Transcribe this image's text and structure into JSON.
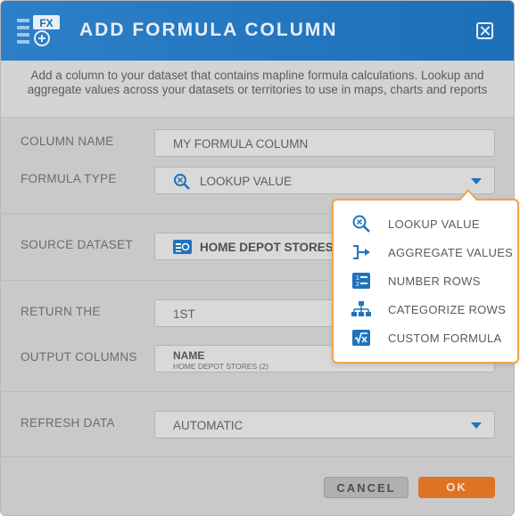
{
  "dialog": {
    "title": "ADD FORMULA COLUMN",
    "logo_text": "FX",
    "description": "Add a column to your dataset that contains mapline formula calculations. Lookup and aggregate values across your datasets or territories to use in maps, charts and reports"
  },
  "form": {
    "column_name": {
      "label": "COLUMN NAME",
      "value": "MY FORMULA COLUMN"
    },
    "formula_type": {
      "label": "FORMULA TYPE",
      "value": "LOOKUP VALUE"
    },
    "source_dataset": {
      "label": "SOURCE DATASET",
      "value": "HOME DEPOT STORES"
    },
    "return_the": {
      "label": "RETURN THE",
      "value": "1ST"
    },
    "output_columns": {
      "label": "OUTPUT COLUMNS",
      "column": "NAME",
      "source": "HOME DEPOT STORES (2)"
    },
    "refresh_data": {
      "label": "REFRESH DATA",
      "value": "AUTOMATIC"
    }
  },
  "formula_menu": {
    "items": [
      {
        "label": "LOOKUP VALUE",
        "icon": "lookup-icon"
      },
      {
        "label": "AGGREGATE VALUES",
        "icon": "aggregate-icon"
      },
      {
        "label": "NUMBER ROWS",
        "icon": "number-rows-icon"
      },
      {
        "label": "CATEGORIZE ROWS",
        "icon": "categorize-icon"
      },
      {
        "label": "CUSTOM FORMULA",
        "icon": "custom-formula-icon"
      }
    ]
  },
  "buttons": {
    "cancel": "CANCEL",
    "ok": "OK"
  },
  "colors": {
    "header": "#1c6fb8",
    "accent": "#1e73be",
    "ok_button": "#de7225",
    "menu_border": "#f0a44a"
  }
}
